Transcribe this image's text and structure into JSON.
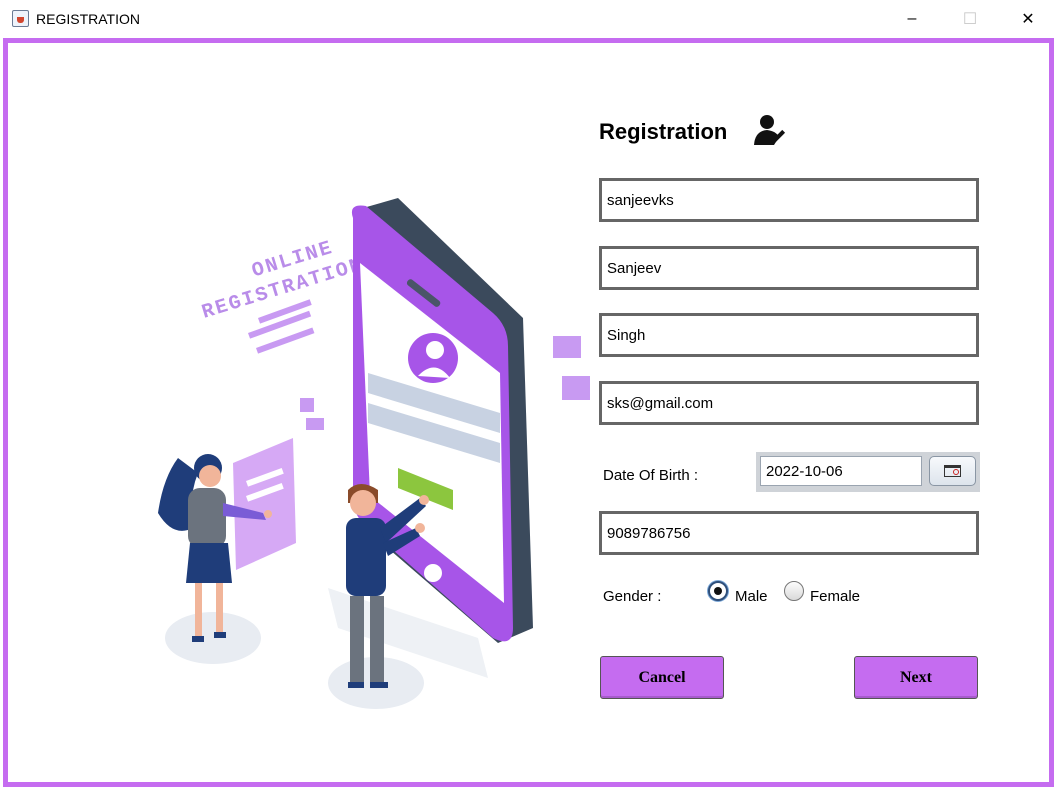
{
  "window": {
    "title": "REGISTRATION",
    "minimize": "–",
    "maximize": "☐",
    "close": "✕"
  },
  "illustration": {
    "text_line1": "ONLINE",
    "text_line2": "REGISTRATION"
  },
  "form": {
    "heading": "Registration",
    "username": "sanjeevks",
    "first_name": "Sanjeev",
    "last_name": "Singh",
    "email": "sks@gmail.com",
    "dob_label": "Date Of Birth :",
    "dob_value": "2022-10-06",
    "phone": "9089786756",
    "gender_label": "Gender :",
    "gender_options": [
      "Male",
      "Female"
    ],
    "gender_selected": "Male",
    "cancel_label": "Cancel",
    "next_label": "Next"
  },
  "colors": {
    "accent": "#c56cf0",
    "field_border": "#666666"
  }
}
